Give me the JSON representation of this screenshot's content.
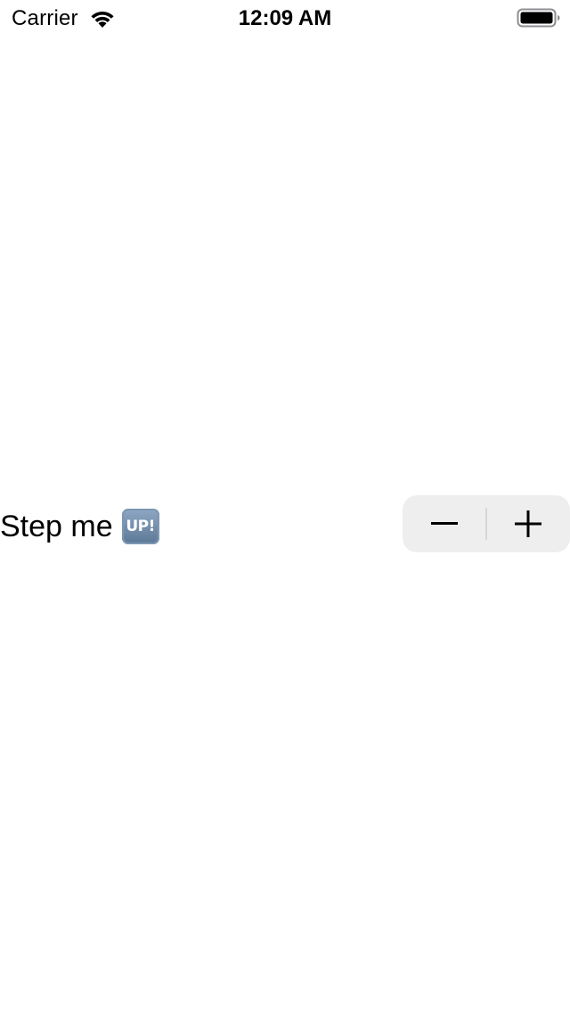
{
  "status_bar": {
    "carrier": "Carrier",
    "time": "12:09 AM",
    "icons": [
      "wifi-icon",
      "battery-icon"
    ]
  },
  "main": {
    "label": "Step me",
    "label_badge": "UP!",
    "stepper": {
      "decrement_icon": "minus-icon",
      "increment_icon": "plus-icon",
      "background_color": "#eeeeef"
    }
  }
}
